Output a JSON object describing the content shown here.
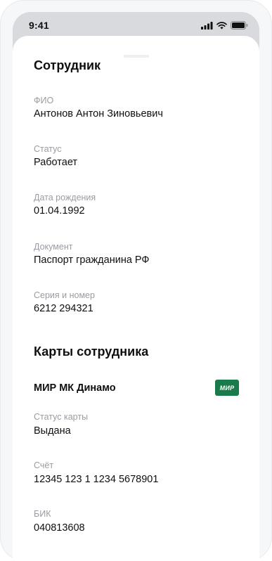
{
  "status_bar": {
    "time": "9:41"
  },
  "employee": {
    "title": "Сотрудник",
    "fields": [
      {
        "label": "ФИО",
        "value": "Антонов Антон Зиновьевич"
      },
      {
        "label": "Статус",
        "value": "Работает"
      },
      {
        "label": "Дата рождения",
        "value": "01.04.1992"
      },
      {
        "label": "Документ",
        "value": "Паспорт гражданина РФ"
      },
      {
        "label": "Серия и номер",
        "value": "6212 294321"
      }
    ]
  },
  "cards": {
    "title": "Карты сотрудника",
    "card_name": "МИР МК Динамо",
    "logo_text": "МИР",
    "logo_color": "#1b7a4a",
    "fields": [
      {
        "label": "Статус карты",
        "value": "Выдана"
      },
      {
        "label": "Счёт",
        "value": "12345 123 1 1234 5678901"
      },
      {
        "label": "БИК",
        "value": "040813608"
      }
    ]
  }
}
